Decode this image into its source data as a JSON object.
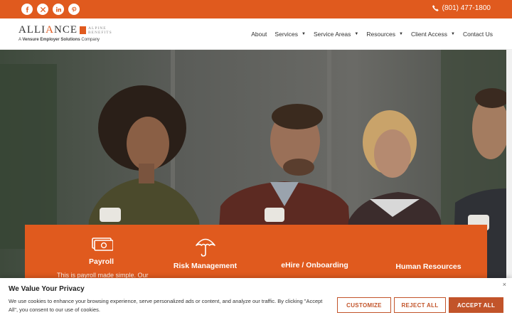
{
  "topbar": {
    "social_icons": [
      "facebook-icon",
      "x-twitter-icon",
      "linkedin-icon",
      "pinterest-icon"
    ],
    "phone": "(801) 477-1800"
  },
  "logo": {
    "name_part1": "ALLI",
    "name_accent": "A",
    "name_part2": "NCE",
    "alpine_line1": "ALPINE",
    "alpine_line2": "BENEFITS",
    "tagline_prefix": "A ",
    "tagline_bold": "Vensure Employer Solutions",
    "tagline_suffix": " Company"
  },
  "nav": {
    "items": [
      {
        "label": "About",
        "dropdown": false
      },
      {
        "label": "Services",
        "dropdown": true
      },
      {
        "label": "Service Areas",
        "dropdown": true
      },
      {
        "label": "Resources",
        "dropdown": true
      },
      {
        "label": "Client Access",
        "dropdown": true
      },
      {
        "label": "Contact Us",
        "dropdown": false
      }
    ]
  },
  "services": {
    "items": [
      {
        "title": "Payroll",
        "text": "This is payroll made simple. Our",
        "icon": "money-icon"
      },
      {
        "title": "Risk Management",
        "text": "",
        "icon": "umbrella-icon"
      },
      {
        "title": "eHire / Onboarding",
        "text": "",
        "icon": ""
      },
      {
        "title": "Human Resources",
        "text": "",
        "icon": ""
      }
    ]
  },
  "cookie": {
    "title": "We Value Your Privacy",
    "text": "We use cookies to enhance your browsing experience, serve personalized ads or content, and analyze our traffic. By clicking \"Accept All\", you consent to our use of cookies.",
    "customize": "CUSTOMIZE",
    "reject": "REJECT ALL",
    "accept": "ACCEPT ALL",
    "close": "×"
  },
  "colors": {
    "brand_orange": "#e05a1e",
    "button_rust": "#c2542a"
  }
}
